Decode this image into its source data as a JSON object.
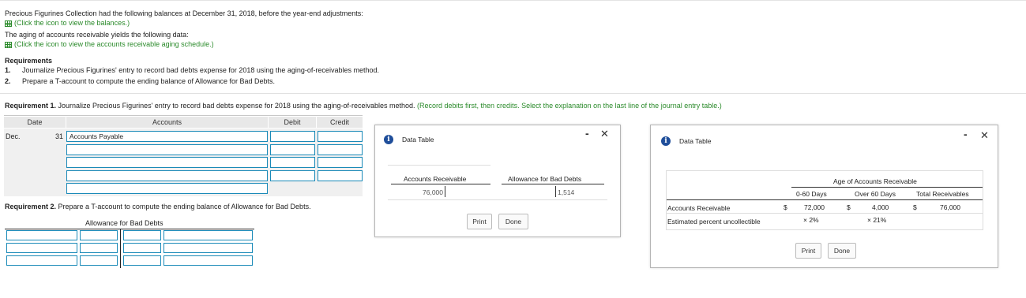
{
  "intro": {
    "line1": "Precious Figurines Collection had the following balances at December 31, 2018, before the year-end adjustments:",
    "link1": "(Click the icon to view the balances.)",
    "line2": "The aging of accounts receivable yields the following data:",
    "link2": "(Click the icon to view the accounts receivable aging schedule.)"
  },
  "requirements": {
    "heading": "Requirements",
    "items": [
      {
        "num": "1.",
        "text": "Journalize Precious Figurines' entry to record bad debts expense for 2018 using the aging-of-receivables method."
      },
      {
        "num": "2.",
        "text": "Prepare a T-account to compute the ending balance of Allowance for Bad Debts."
      }
    ]
  },
  "req1": {
    "label": "Requirement 1.",
    "text": " Journalize Precious Figurines' entry to record bad debts expense for 2018 using the aging-of-receivables method.",
    "hint": " (Record debits first, then credits. Select the explanation on the last line of the journal entry table.)"
  },
  "journal": {
    "headers": {
      "date": "Date",
      "accounts": "Accounts",
      "debit": "Debit",
      "credit": "Credit"
    },
    "month": "Dec.",
    "day": "31",
    "first_account": "Accounts Payable"
  },
  "req2": {
    "label": "Requirement 2.",
    "text": " Prepare a T-account to compute the ending balance of Allowance for Bad Debts.",
    "taccount_title": "Allowance for Bad Debts"
  },
  "dialog1": {
    "title": "Data Table",
    "col1": "Accounts Receivable",
    "col2": "Allowance for Bad Debts",
    "val1": "76,000",
    "val2": "1,514",
    "print": "Print",
    "done": "Done"
  },
  "dialog2": {
    "title": "Data Table",
    "group_header": "Age of Accounts Receivable",
    "col_0_60": "0-60 Days",
    "col_over60": "Over 60 Days",
    "col_total": "Total Receivables",
    "row1_label": "Accounts Receivable",
    "row1": {
      "cur1": "$",
      "v1": "72,000",
      "cur2": "$",
      "v2": "4,000",
      "cur3": "$",
      "v3": "76,000"
    },
    "row2_label": "Estimated percent uncollectible",
    "row2": {
      "p1": "× 2%",
      "p2": "× 21%"
    },
    "print": "Print",
    "done": "Done"
  },
  "icons": {
    "table": "table-icon",
    "info": "info-icon",
    "minimize": "minimize-icon",
    "close": "close-icon"
  },
  "colors": {
    "link": "#2a8a2a",
    "input_border": "#1a8ab8",
    "info": "#1f4e9a"
  }
}
